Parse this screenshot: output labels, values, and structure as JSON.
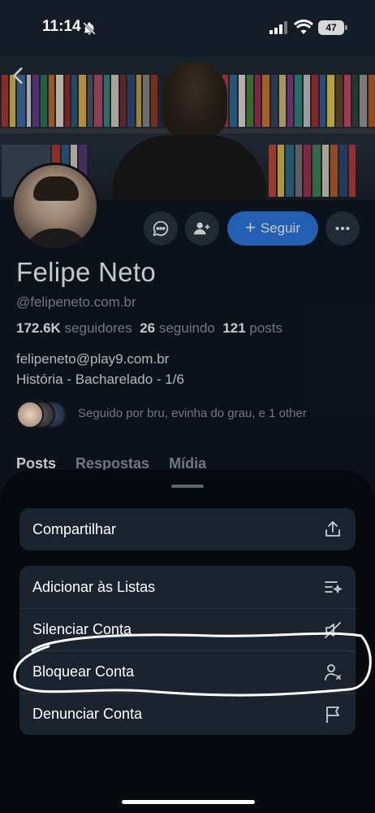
{
  "status_bar": {
    "time": "11:14",
    "battery": "47"
  },
  "profile": {
    "name": "Felipe Neto",
    "handle": "@felipeneto.com.br",
    "stats": {
      "followers_count": "172.6K",
      "followers_label": "seguidores",
      "following_count": "26",
      "following_label": "seguindo",
      "posts_count": "121",
      "posts_label": "posts"
    },
    "bio_line1": "felipeneto@play9.com.br",
    "bio_line2": "História - Bacharelado - 1/6",
    "followed_by": "Seguido por bru, evinha do grau, e 1 other"
  },
  "actions": {
    "follow_label": "Seguir"
  },
  "tabs": [
    {
      "label": "Posts",
      "active": true
    },
    {
      "label": "Respostas",
      "active": false
    },
    {
      "label": "Mídia",
      "active": false
    }
  ],
  "sheet": {
    "share": {
      "label": "Compartilhar",
      "icon": "share-icon"
    },
    "items": [
      {
        "label": "Adicionar às Listas",
        "icon": "list-add-icon"
      },
      {
        "label": "Silenciar Conta",
        "icon": "speaker-mute-icon"
      },
      {
        "label": "Bloquear Conta",
        "icon": "person-x-icon"
      },
      {
        "label": "Denunciar Conta",
        "icon": "flag-icon"
      }
    ]
  },
  "colors": {
    "accent": "#2e7be6",
    "background": "#101821",
    "sheet": "#06090d",
    "sheet_group": "#1a232e",
    "muted_text": "#8e9aa8"
  }
}
